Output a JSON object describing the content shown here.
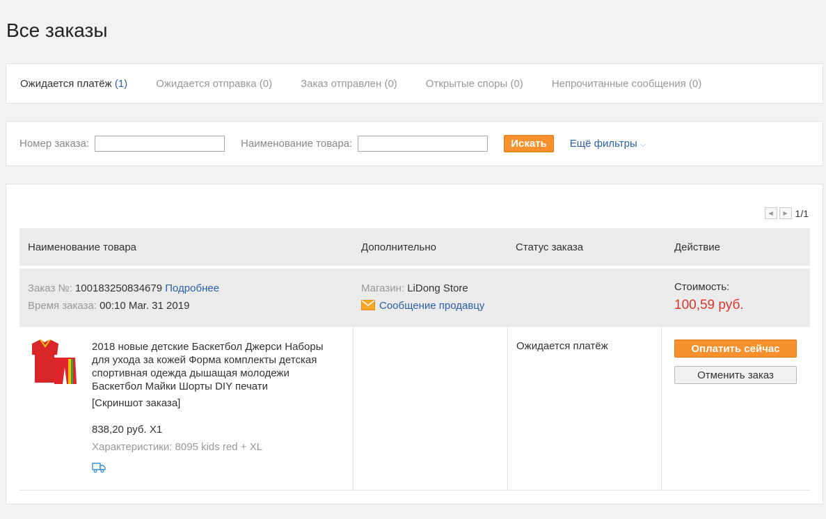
{
  "page": {
    "title": "Все заказы"
  },
  "tabs": [
    {
      "label": "Ожидается платёж",
      "count": "(1)"
    },
    {
      "label": "Ожидается отправка (0)"
    },
    {
      "label": "Заказ отправлен (0)"
    },
    {
      "label": "Открытые споры (0)"
    },
    {
      "label": "Непрочитанные сообщения (0)"
    }
  ],
  "filters": {
    "order_number_label": "Номер заказа:",
    "order_number_value": "",
    "product_name_label": "Наименование товара:",
    "product_name_value": "",
    "search_button": "Искать",
    "more_filters": "Ещё фильтры"
  },
  "pager": {
    "text": "1/1"
  },
  "table": {
    "headers": [
      "Наименование товара",
      "Дополнительно",
      "Статус заказа",
      "Действие"
    ]
  },
  "order": {
    "number_label": "Заказ №:",
    "number": "100183250834679",
    "details_link": "Подробнее",
    "time_label": "Время заказа:",
    "time": "00:10 Mar. 31 2019",
    "store_label": "Магазин:",
    "store": "LiDong Store",
    "message_link": "Сообщение продавцу",
    "cost_label": "Стоимость:",
    "cost": "100,59 руб.",
    "product_title": "2018 новые детские Баскетбол Джерси Наборы для ухода за кожей Форма комплекты детская спортивная одежда дышащая молодежи Баскетбол Майки Шорты DIY печати",
    "snapshot": "[Скриншот заказа]",
    "price_qty": "838,20 руб. X1",
    "specs": "Характеристики: 8095 kids red + XL",
    "status": "Ожидается платёж",
    "pay_button": "Оплатить сейчас",
    "cancel_button": "Отменить заказ"
  },
  "colors": {
    "accent_orange": "#f6912d",
    "link_blue": "#2b5fa8",
    "price_red": "#d9352b"
  }
}
